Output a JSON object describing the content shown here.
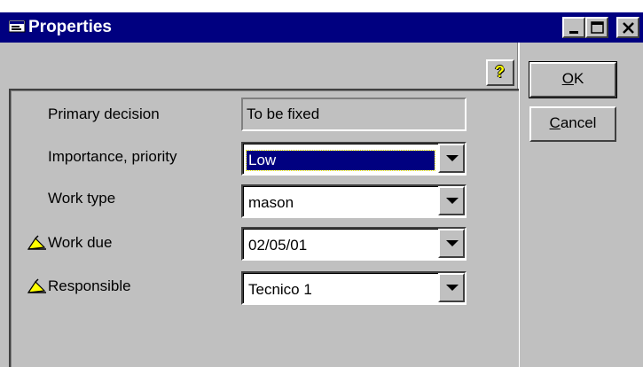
{
  "window": {
    "title": "Properties",
    "controls": [
      "minimize-icon",
      "maximize-icon",
      "close-icon"
    ]
  },
  "buttons": {
    "ok_label": "OK",
    "ok_mnemonic": "O",
    "ok_rest": "K",
    "cancel_label": "Cancel",
    "cancel_mnemonic": "C",
    "cancel_rest": "ancel",
    "help_icon": "question-mark-icon"
  },
  "form": {
    "primary_decision": {
      "label": "Primary decision",
      "value": "To be fixed"
    },
    "importance": {
      "label": "Importance, priority",
      "value": "Low"
    },
    "work_type": {
      "label": "Work type",
      "value": "mason"
    },
    "work_due": {
      "label": "Work due",
      "value": "02/05/01",
      "icon": "pencil-icon"
    },
    "responsible": {
      "label": "Responsible",
      "value": "Tecnico 1",
      "icon": "pencil-icon"
    }
  },
  "colors": {
    "titlebar": "#000080",
    "face": "#c0c0c0",
    "selection": "#000080"
  }
}
